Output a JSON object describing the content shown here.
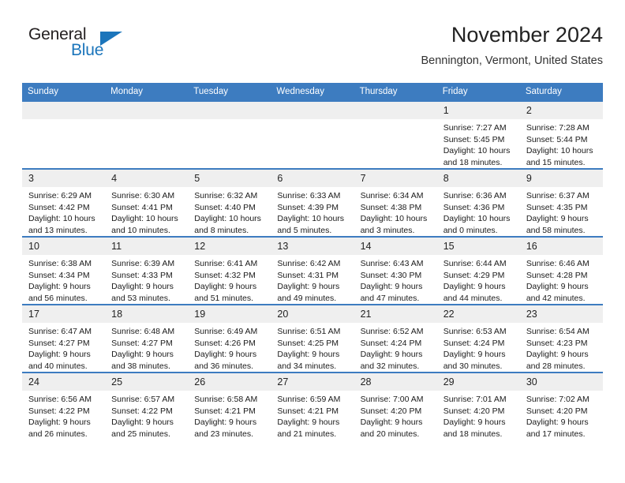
{
  "logo": {
    "word1": "General",
    "word2": "Blue",
    "triangle_color": "#1b75bb",
    "icon": "triangle-icon"
  },
  "header": {
    "title": "November 2024",
    "subtitle": "Bennington, Vermont, United States"
  },
  "theme": {
    "header_bg": "#3d7cc0",
    "header_text": "#ffffff",
    "daynum_bg": "#efefef",
    "row_border": "#3d7cc0",
    "page_bg": "#ffffff"
  },
  "calendar": {
    "columns": [
      "Sunday",
      "Monday",
      "Tuesday",
      "Wednesday",
      "Thursday",
      "Friday",
      "Saturday"
    ],
    "weeks": [
      [
        {
          "day": "",
          "lines": []
        },
        {
          "day": "",
          "lines": []
        },
        {
          "day": "",
          "lines": []
        },
        {
          "day": "",
          "lines": []
        },
        {
          "day": "",
          "lines": []
        },
        {
          "day": "1",
          "lines": [
            "Sunrise: 7:27 AM",
            "Sunset: 5:45 PM",
            "Daylight: 10 hours",
            "and 18 minutes."
          ]
        },
        {
          "day": "2",
          "lines": [
            "Sunrise: 7:28 AM",
            "Sunset: 5:44 PM",
            "Daylight: 10 hours",
            "and 15 minutes."
          ]
        }
      ],
      [
        {
          "day": "3",
          "lines": [
            "Sunrise: 6:29 AM",
            "Sunset: 4:42 PM",
            "Daylight: 10 hours",
            "and 13 minutes."
          ]
        },
        {
          "day": "4",
          "lines": [
            "Sunrise: 6:30 AM",
            "Sunset: 4:41 PM",
            "Daylight: 10 hours",
            "and 10 minutes."
          ]
        },
        {
          "day": "5",
          "lines": [
            "Sunrise: 6:32 AM",
            "Sunset: 4:40 PM",
            "Daylight: 10 hours",
            "and 8 minutes."
          ]
        },
        {
          "day": "6",
          "lines": [
            "Sunrise: 6:33 AM",
            "Sunset: 4:39 PM",
            "Daylight: 10 hours",
            "and 5 minutes."
          ]
        },
        {
          "day": "7",
          "lines": [
            "Sunrise: 6:34 AM",
            "Sunset: 4:38 PM",
            "Daylight: 10 hours",
            "and 3 minutes."
          ]
        },
        {
          "day": "8",
          "lines": [
            "Sunrise: 6:36 AM",
            "Sunset: 4:36 PM",
            "Daylight: 10 hours",
            "and 0 minutes."
          ]
        },
        {
          "day": "9",
          "lines": [
            "Sunrise: 6:37 AM",
            "Sunset: 4:35 PM",
            "Daylight: 9 hours",
            "and 58 minutes."
          ]
        }
      ],
      [
        {
          "day": "10",
          "lines": [
            "Sunrise: 6:38 AM",
            "Sunset: 4:34 PM",
            "Daylight: 9 hours",
            "and 56 minutes."
          ]
        },
        {
          "day": "11",
          "lines": [
            "Sunrise: 6:39 AM",
            "Sunset: 4:33 PM",
            "Daylight: 9 hours",
            "and 53 minutes."
          ]
        },
        {
          "day": "12",
          "lines": [
            "Sunrise: 6:41 AM",
            "Sunset: 4:32 PM",
            "Daylight: 9 hours",
            "and 51 minutes."
          ]
        },
        {
          "day": "13",
          "lines": [
            "Sunrise: 6:42 AM",
            "Sunset: 4:31 PM",
            "Daylight: 9 hours",
            "and 49 minutes."
          ]
        },
        {
          "day": "14",
          "lines": [
            "Sunrise: 6:43 AM",
            "Sunset: 4:30 PM",
            "Daylight: 9 hours",
            "and 47 minutes."
          ]
        },
        {
          "day": "15",
          "lines": [
            "Sunrise: 6:44 AM",
            "Sunset: 4:29 PM",
            "Daylight: 9 hours",
            "and 44 minutes."
          ]
        },
        {
          "day": "16",
          "lines": [
            "Sunrise: 6:46 AM",
            "Sunset: 4:28 PM",
            "Daylight: 9 hours",
            "and 42 minutes."
          ]
        }
      ],
      [
        {
          "day": "17",
          "lines": [
            "Sunrise: 6:47 AM",
            "Sunset: 4:27 PM",
            "Daylight: 9 hours",
            "and 40 minutes."
          ]
        },
        {
          "day": "18",
          "lines": [
            "Sunrise: 6:48 AM",
            "Sunset: 4:27 PM",
            "Daylight: 9 hours",
            "and 38 minutes."
          ]
        },
        {
          "day": "19",
          "lines": [
            "Sunrise: 6:49 AM",
            "Sunset: 4:26 PM",
            "Daylight: 9 hours",
            "and 36 minutes."
          ]
        },
        {
          "day": "20",
          "lines": [
            "Sunrise: 6:51 AM",
            "Sunset: 4:25 PM",
            "Daylight: 9 hours",
            "and 34 minutes."
          ]
        },
        {
          "day": "21",
          "lines": [
            "Sunrise: 6:52 AM",
            "Sunset: 4:24 PM",
            "Daylight: 9 hours",
            "and 32 minutes."
          ]
        },
        {
          "day": "22",
          "lines": [
            "Sunrise: 6:53 AM",
            "Sunset: 4:24 PM",
            "Daylight: 9 hours",
            "and 30 minutes."
          ]
        },
        {
          "day": "23",
          "lines": [
            "Sunrise: 6:54 AM",
            "Sunset: 4:23 PM",
            "Daylight: 9 hours",
            "and 28 minutes."
          ]
        }
      ],
      [
        {
          "day": "24",
          "lines": [
            "Sunrise: 6:56 AM",
            "Sunset: 4:22 PM",
            "Daylight: 9 hours",
            "and 26 minutes."
          ]
        },
        {
          "day": "25",
          "lines": [
            "Sunrise: 6:57 AM",
            "Sunset: 4:22 PM",
            "Daylight: 9 hours",
            "and 25 minutes."
          ]
        },
        {
          "day": "26",
          "lines": [
            "Sunrise: 6:58 AM",
            "Sunset: 4:21 PM",
            "Daylight: 9 hours",
            "and 23 minutes."
          ]
        },
        {
          "day": "27",
          "lines": [
            "Sunrise: 6:59 AM",
            "Sunset: 4:21 PM",
            "Daylight: 9 hours",
            "and 21 minutes."
          ]
        },
        {
          "day": "28",
          "lines": [
            "Sunrise: 7:00 AM",
            "Sunset: 4:20 PM",
            "Daylight: 9 hours",
            "and 20 minutes."
          ]
        },
        {
          "day": "29",
          "lines": [
            "Sunrise: 7:01 AM",
            "Sunset: 4:20 PM",
            "Daylight: 9 hours",
            "and 18 minutes."
          ]
        },
        {
          "day": "30",
          "lines": [
            "Sunrise: 7:02 AM",
            "Sunset: 4:20 PM",
            "Daylight: 9 hours",
            "and 17 minutes."
          ]
        }
      ]
    ]
  }
}
